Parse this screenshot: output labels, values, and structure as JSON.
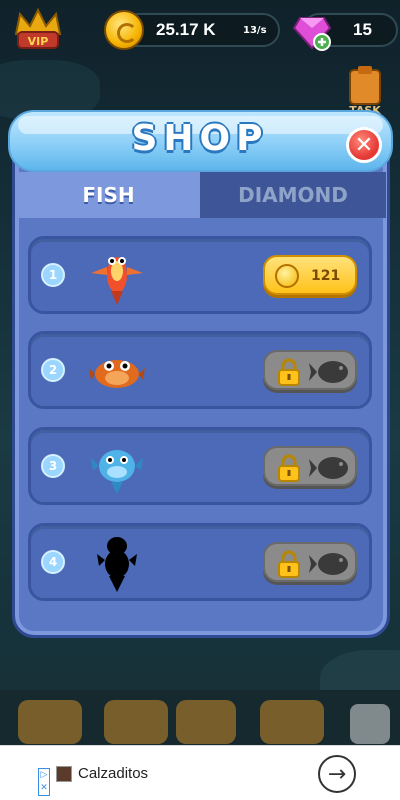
{
  "hud": {
    "vip_label": "VIP",
    "coins": "25.17 K",
    "rate": "13/s",
    "gems": "15",
    "task_label": "TASK"
  },
  "shop": {
    "title": "SHOP",
    "tabs": [
      {
        "label": "FISH",
        "active": true
      },
      {
        "label": "DIAMOND",
        "active": false
      }
    ],
    "items": [
      {
        "index": "1",
        "price": "121",
        "locked": false,
        "fish": "red-fish-icon"
      },
      {
        "index": "2",
        "price": "",
        "locked": true,
        "fish": "orange-fish-icon"
      },
      {
        "index": "3",
        "price": "",
        "locked": true,
        "fish": "blue-fish-icon"
      },
      {
        "index": "4",
        "price": "",
        "locked": true,
        "fish": "silhouette-fish-icon"
      }
    ]
  },
  "ad": {
    "text": "Calzaditos"
  },
  "colors": {
    "panel": "#5a78c4",
    "header": "#8ccff7",
    "coin_button": "#ffc21a",
    "locked_button": "#8b8b8b",
    "close": "#e53935"
  }
}
